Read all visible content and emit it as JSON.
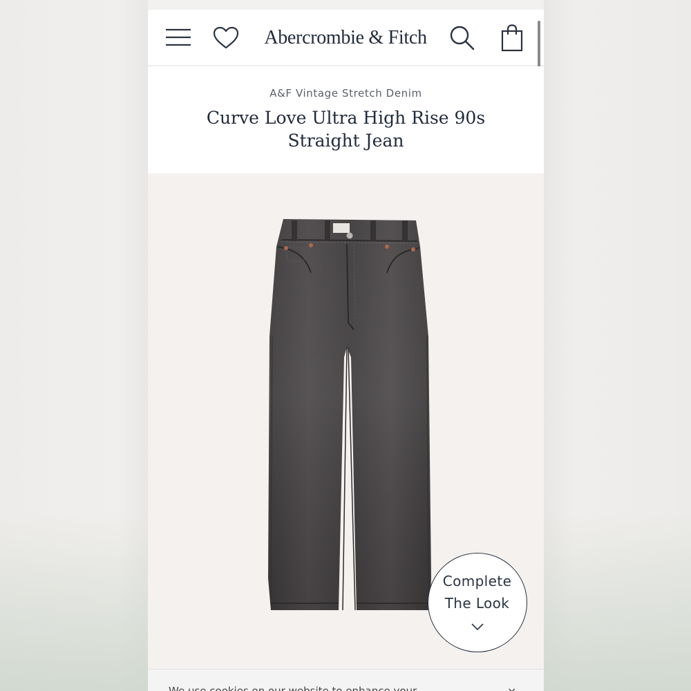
{
  "header": {
    "brand": "Abercrombie & Fitch",
    "icons": {
      "menu": "menu-icon",
      "wishlist": "heart-icon",
      "search": "search-icon",
      "bag": "shopping-bag-icon"
    }
  },
  "product": {
    "collection": "A&F Vintage Stretch Denim",
    "title": "Curve Love Ultra High Rise 90s Straight Jean"
  },
  "complete_look": {
    "line1": "Complete",
    "line2": "The Look"
  },
  "cookie_banner": {
    "text": "We use cookies on our website to enhance your",
    "close": "×"
  },
  "colors": {
    "brand_navy": "#1f2a3a",
    "denim": "#3f3c3d",
    "image_bg": "#f4f1ee"
  }
}
